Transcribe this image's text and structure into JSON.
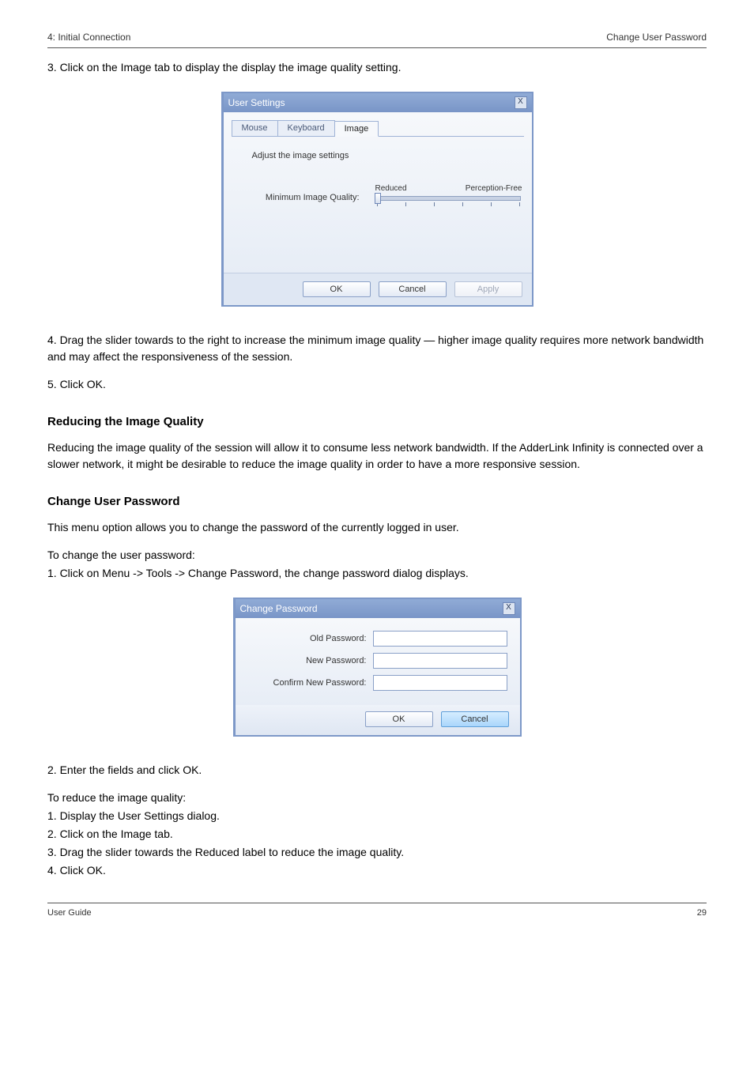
{
  "header": {
    "left": "4: Initial Connection",
    "right": "Change User Password"
  },
  "text": {
    "p1": "3. Click on the Image tab to display the display the image quality setting.",
    "p2": "4. Drag the slider towards to the right to increase the minimum image quality — higher image quality requires more network bandwidth and may affect the responsiveness of the session.",
    "p3": "5. Click OK.",
    "sec1_title": "Reducing the Image Quality",
    "sec1_p": "Reducing the image quality of the session will allow it to consume less network bandwidth. If the AdderLink Infinity is connected over a slower network, it might be desirable to reduce the image quality in order to have a more responsive session.",
    "sec2_title": "Change User Password",
    "sec2_p": "This menu option allows you to change the password of the currently logged in user.",
    "to_change": "To change the user password:",
    "step1": "1. Click on  Menu -> Tools -> Change Password, the change password dialog displays.",
    "step2": "2. Enter the fields and click OK.",
    "to_reduce": "To reduce the image quality:",
    "r1": "1. Display the User Settings dialog.",
    "r2": "2. Click on the  Image tab.",
    "r3": "3. Drag the slider towards the  Reduced label to reduce the image quality.",
    "r4": "4. Click  OK."
  },
  "dlg1": {
    "title": "User Settings",
    "tabs": {
      "mouse": "Mouse",
      "keyboard": "Keyboard",
      "image": "Image"
    },
    "instruction": "Adjust the image settings",
    "slider_label": "Minimum Image Quality:",
    "slider_low": "Reduced",
    "slider_high": "Perception-Free",
    "ok": "OK",
    "cancel": "Cancel",
    "apply": "Apply"
  },
  "dlg2": {
    "title": "Change Password",
    "old": "Old Password:",
    "new": "New Password:",
    "confirm": "Confirm New Password:",
    "ok": "OK",
    "cancel": "Cancel"
  },
  "footer": {
    "left": "User Guide",
    "right": "29"
  }
}
